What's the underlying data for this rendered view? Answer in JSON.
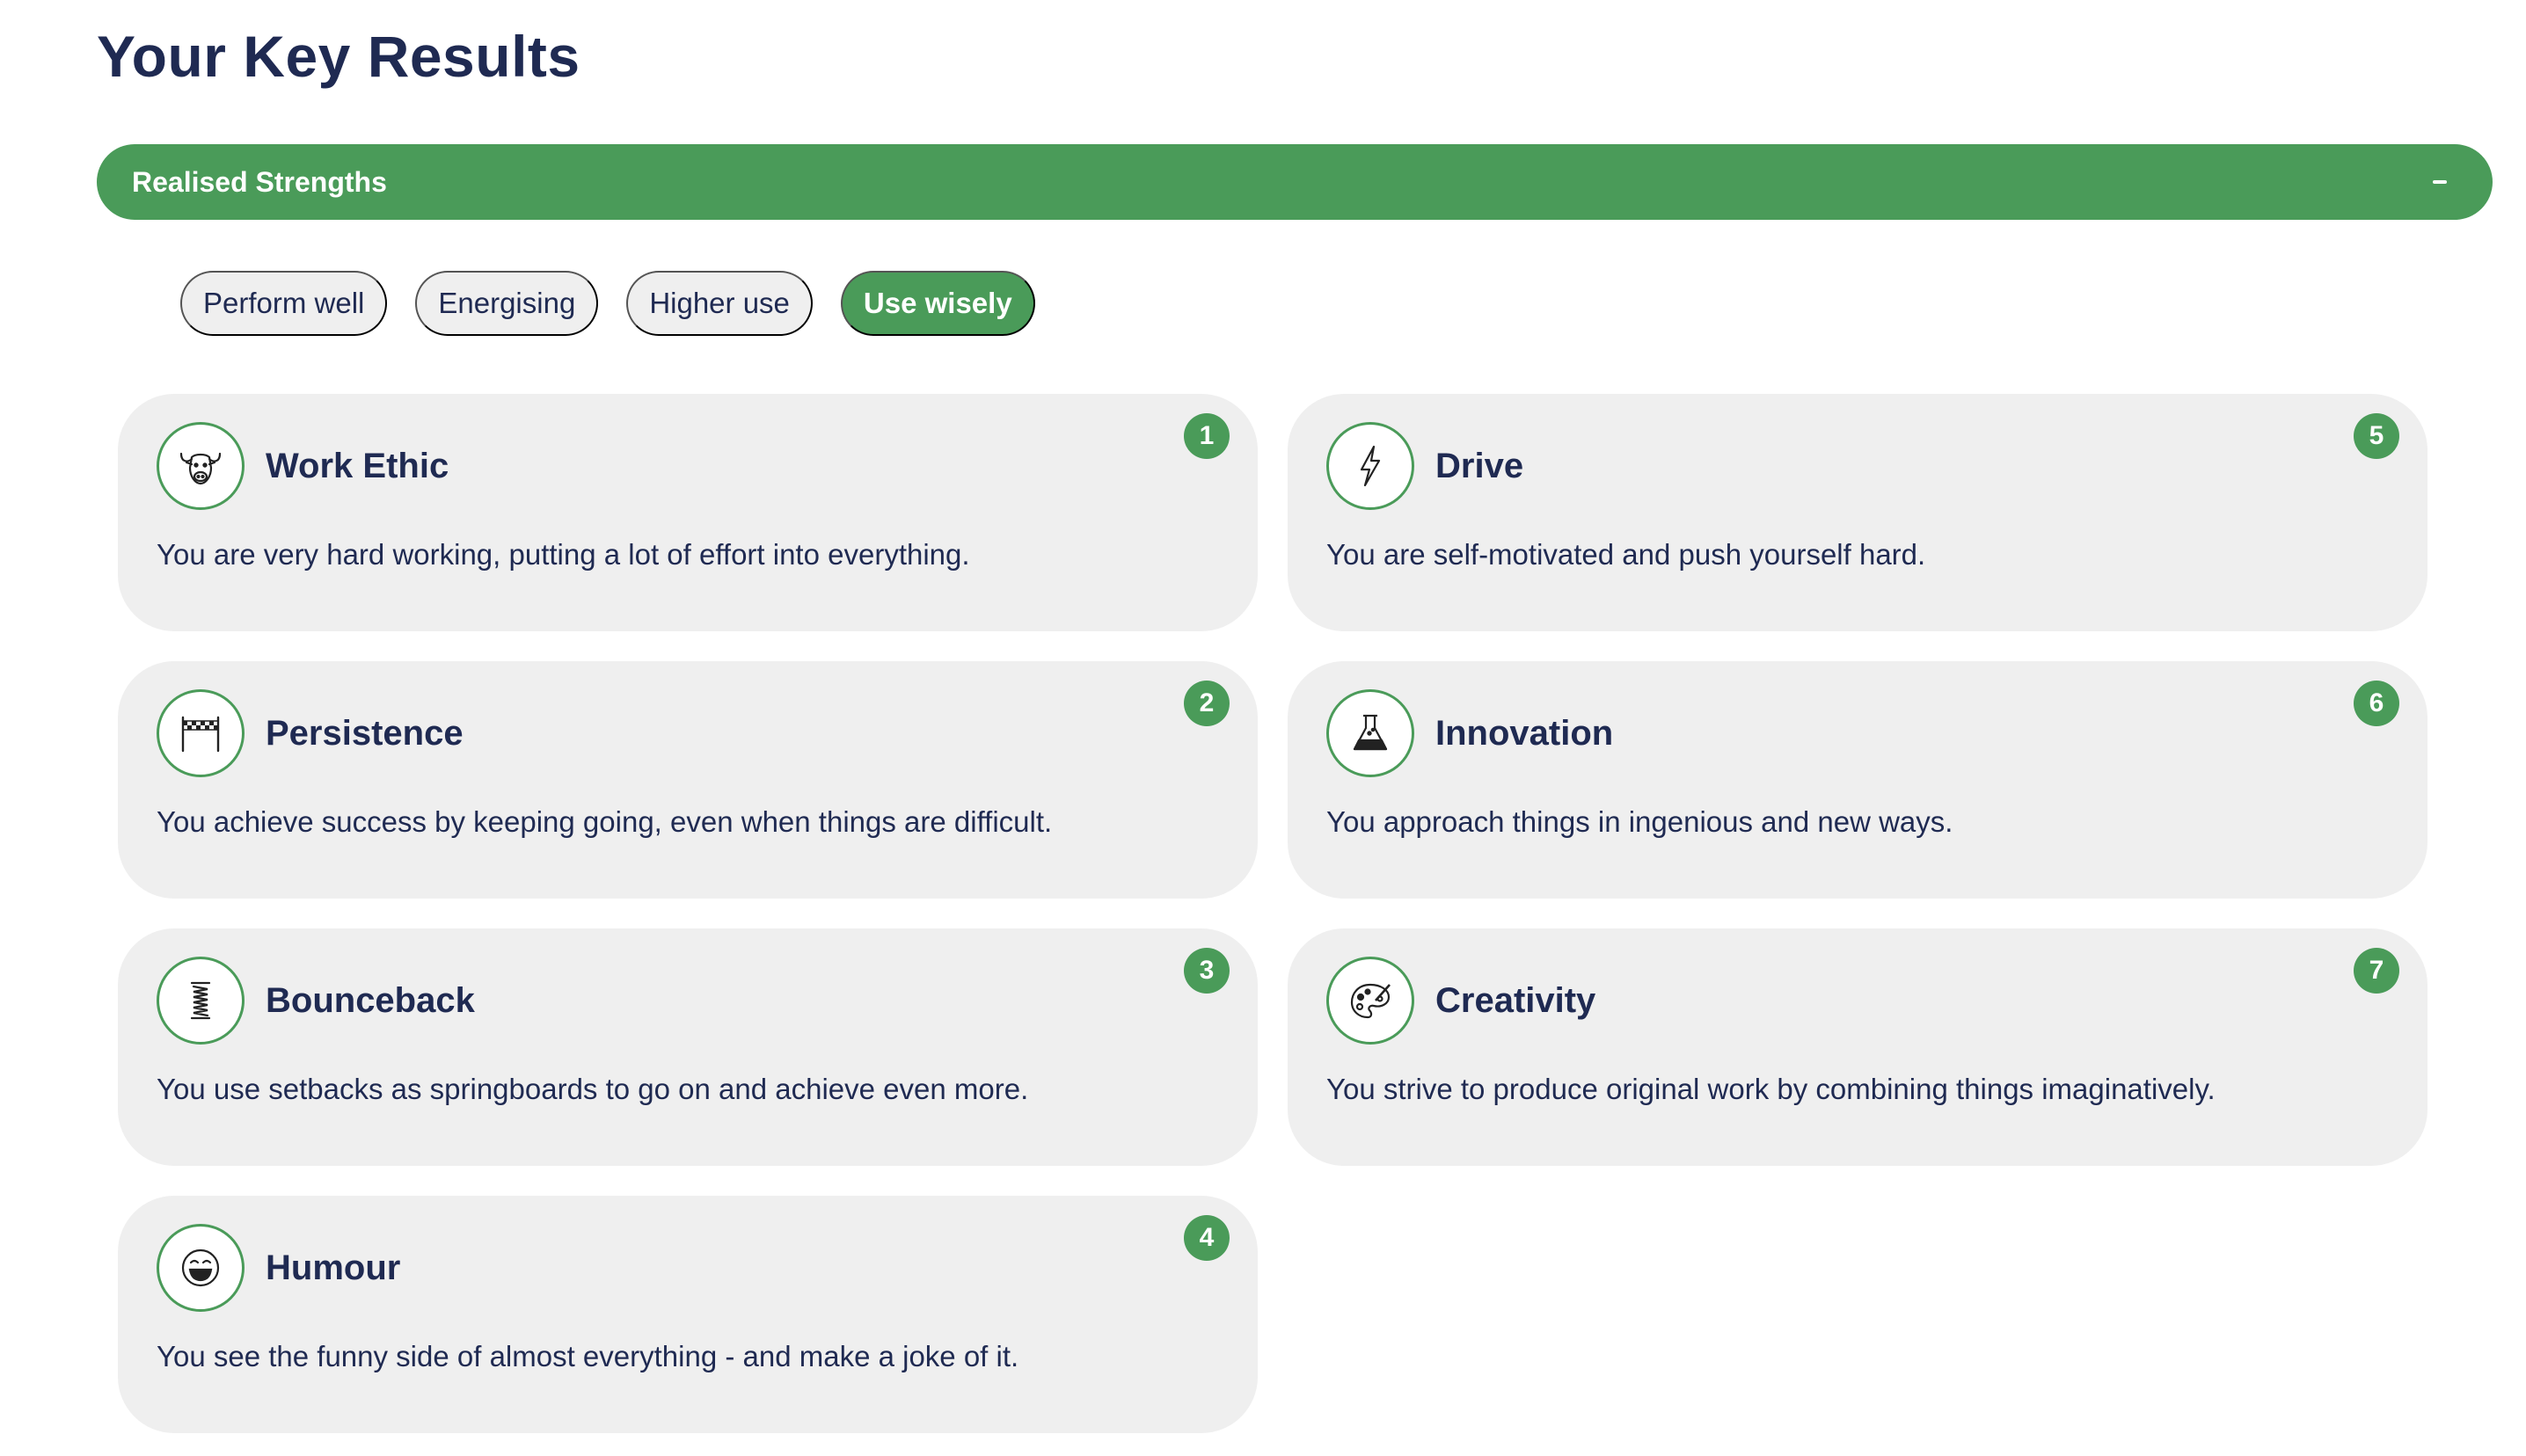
{
  "page": {
    "title": "Your Key Results"
  },
  "section": {
    "title": "Realised Strengths",
    "toggle_icon": "minus-icon"
  },
  "filters": [
    {
      "label": "Perform well",
      "active": false
    },
    {
      "label": "Energising",
      "active": false
    },
    {
      "label": "Higher use",
      "active": false
    },
    {
      "label": "Use wisely",
      "active": true
    }
  ],
  "colors": {
    "accent": "#4a9b59",
    "text": "#1f2a52",
    "card_bg": "#efefef"
  },
  "strengths": [
    {
      "rank": "1",
      "title": "Work Ethic",
      "description": "You are very hard working, putting a lot of effort into everything.",
      "icon": "ox-icon"
    },
    {
      "rank": "5",
      "title": "Drive",
      "description": "You are self-motivated and push yourself hard.",
      "icon": "lightning-icon"
    },
    {
      "rank": "2",
      "title": "Persistence",
      "description": "You achieve success by keeping going, even when things are difficult.",
      "icon": "finish-line-icon"
    },
    {
      "rank": "6",
      "title": "Innovation",
      "description": "You approach things in ingenious and new ways.",
      "icon": "flask-icon"
    },
    {
      "rank": "3",
      "title": "Bounceback",
      "description": "You use setbacks as springboards to go on and achieve even more.",
      "icon": "spring-icon"
    },
    {
      "rank": "7",
      "title": "Creativity",
      "description": "You strive to produce original work by combining things imaginatively.",
      "icon": "palette-icon"
    },
    {
      "rank": "4",
      "title": "Humour",
      "description": "You see the funny side of almost everything - and make a joke of it.",
      "icon": "laughing-face-icon"
    }
  ]
}
